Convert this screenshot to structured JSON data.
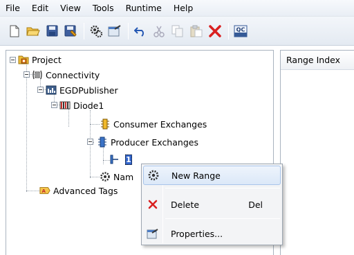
{
  "menu": [
    "File",
    "Edit",
    "View",
    "Tools",
    "Runtime",
    "Help"
  ],
  "toolbar": {
    "buttons": [
      "new-icon",
      "open-folder-icon",
      "save-icon",
      "save-all-icon",
      "configure-icon",
      "properties-icon",
      "undo-icon",
      "cut-icon",
      "copy-icon",
      "paste-icon",
      "delete-icon",
      "qc-icon"
    ],
    "qc_label": "QC"
  },
  "tree": {
    "project": "Project",
    "connectivity": "Connectivity",
    "publisher": "EGDPublisher",
    "device": "Diode1",
    "consumer": "Consumer Exchanges",
    "producer": "Producer Exchanges",
    "exchange": "1",
    "names": "Nam",
    "advanced": "Advanced Tags"
  },
  "right_pane": {
    "column": "Range Index"
  },
  "context_menu": {
    "new_range": "New Range",
    "delete": "Delete",
    "delete_shortcut": "Del",
    "properties": "Properties..."
  },
  "colors": {
    "accent": "#3366cc",
    "delete": "#d92020"
  }
}
